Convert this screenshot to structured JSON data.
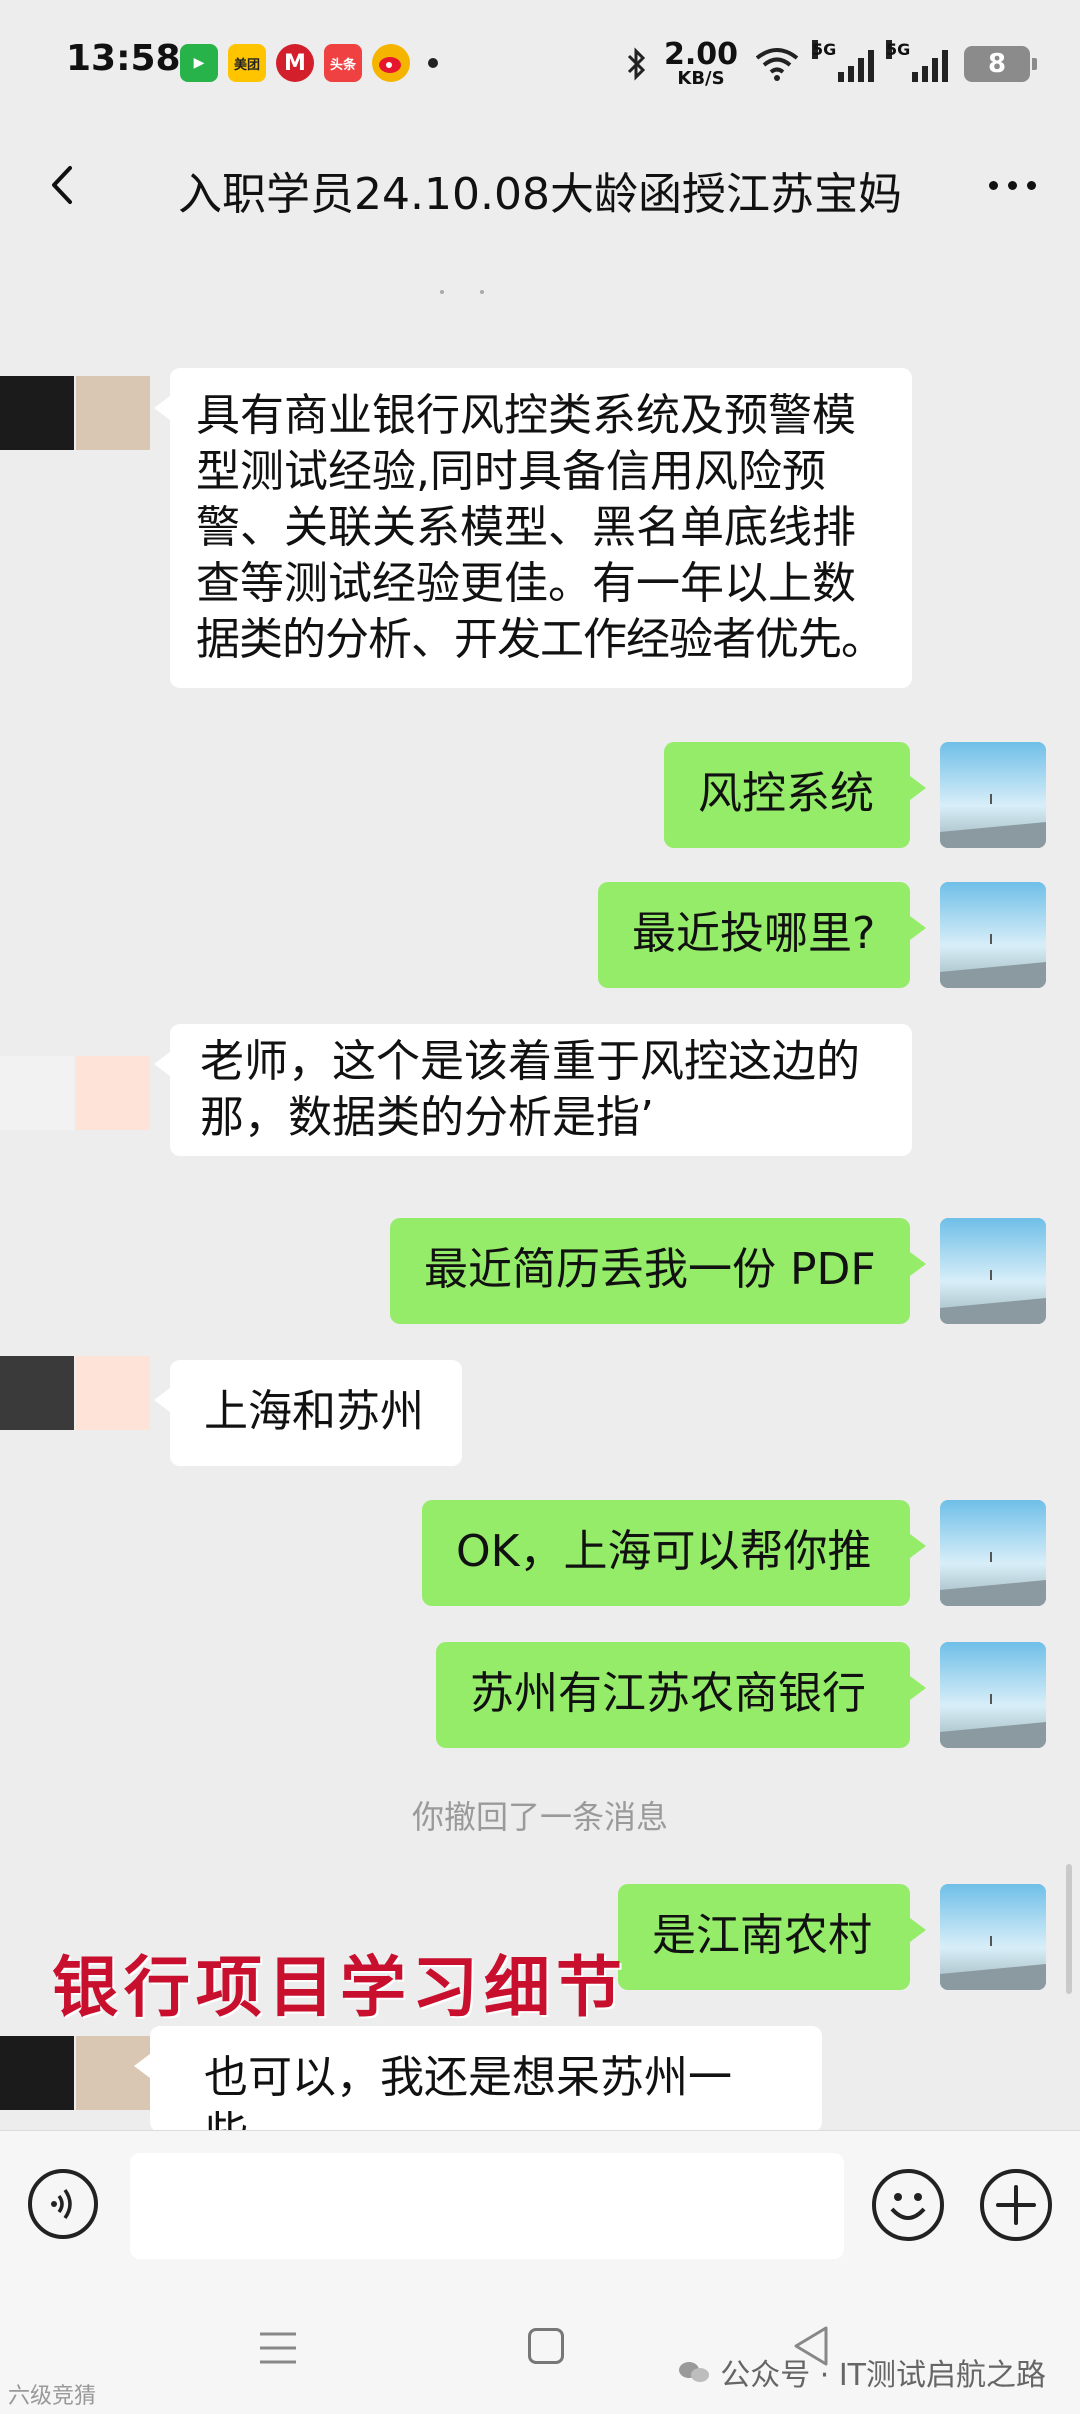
{
  "status_bar": {
    "time": "13:58",
    "app_icons": [
      {
        "name": "video-app-icon",
        "color": "#27b34a",
        "label": ""
      },
      {
        "name": "meituan-icon",
        "color": "#ffc400",
        "label": "美团"
      },
      {
        "name": "mcdonalds-icon",
        "color": "#d21f2b",
        "label": ""
      },
      {
        "name": "toutiao-icon",
        "color": "#f04142",
        "label": "头条"
      },
      {
        "name": "weibo-icon",
        "color": "#f5b400",
        "label": ""
      }
    ],
    "net_speed": "2.00",
    "net_unit": "KB/S",
    "signal_label_1": "5G",
    "signal_label_2": "5G",
    "battery": "8"
  },
  "header": {
    "title": "入职学员24.10.08大龄函授江苏宝妈"
  },
  "messages": [
    {
      "id": "m1",
      "dir": "in",
      "lines": [
        "具有商业银行风控类系统及预警模",
        "型测试经验,同时具备信用风险预",
        "警、关联关系模型、黑名单底线排",
        "查等测试经验更佳。有一年以上数",
        "据类的分析、开发工作经验者优先。"
      ]
    },
    {
      "id": "m2",
      "dir": "out",
      "text": "风控系统"
    },
    {
      "id": "m3",
      "dir": "out",
      "text": "最近投哪里?"
    },
    {
      "id": "m4",
      "dir": "in",
      "lines": [
        "老师，这个是该着重于风控这边的",
        "那，数据类的分析是指’"
      ]
    },
    {
      "id": "m5",
      "dir": "out",
      "text": "最近简历丢我一份 PDF"
    },
    {
      "id": "m6",
      "dir": "in",
      "text": "上海和苏州"
    },
    {
      "id": "m7",
      "dir": "out",
      "text": "OK，上海可以帮你推"
    },
    {
      "id": "m8",
      "dir": "out",
      "text": "苏州有江苏农商银行"
    },
    {
      "id": "m9",
      "dir": "out",
      "text": "是江南农村"
    },
    {
      "id": "m10",
      "dir": "in",
      "text": "也可以，我还是想呆苏州一些"
    }
  ],
  "system_message": "你撤回了一条消息",
  "overlay_caption": "银行项目学习细节",
  "colors": {
    "outgoing_bubble": "#95ec69",
    "incoming_bubble": "#ffffff",
    "background": "#ededed",
    "overlay_text": "#c8102e"
  },
  "watermark": {
    "text": "公众号 · IT测试启航之路",
    "icon": "wechat-official-account-icon"
  },
  "corner_watermark": "六级竞猜"
}
